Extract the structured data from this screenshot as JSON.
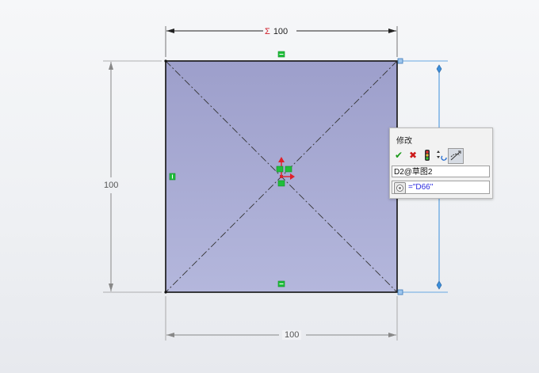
{
  "dimensions": {
    "top": {
      "sigma": "Σ",
      "value": "100"
    },
    "bottom": {
      "value": "100"
    },
    "left": {
      "value": "100"
    }
  },
  "modify_dialog": {
    "title": "修改",
    "toolbar": {
      "ok_icon": "check-icon",
      "cancel_icon": "x-icon",
      "rebuild_icon": "traffic-light-icon",
      "spin_icon": "spin-increment-icon",
      "mark_icon": "mark-dimension-icon"
    },
    "dimension_name": "D2@草图2",
    "value_expression": "=\"D66\""
  },
  "colors": {
    "sketch_fill": "#a8acd4",
    "selected_dimension": "#3b8fdc",
    "relation_badge": "#1fbf3b"
  }
}
